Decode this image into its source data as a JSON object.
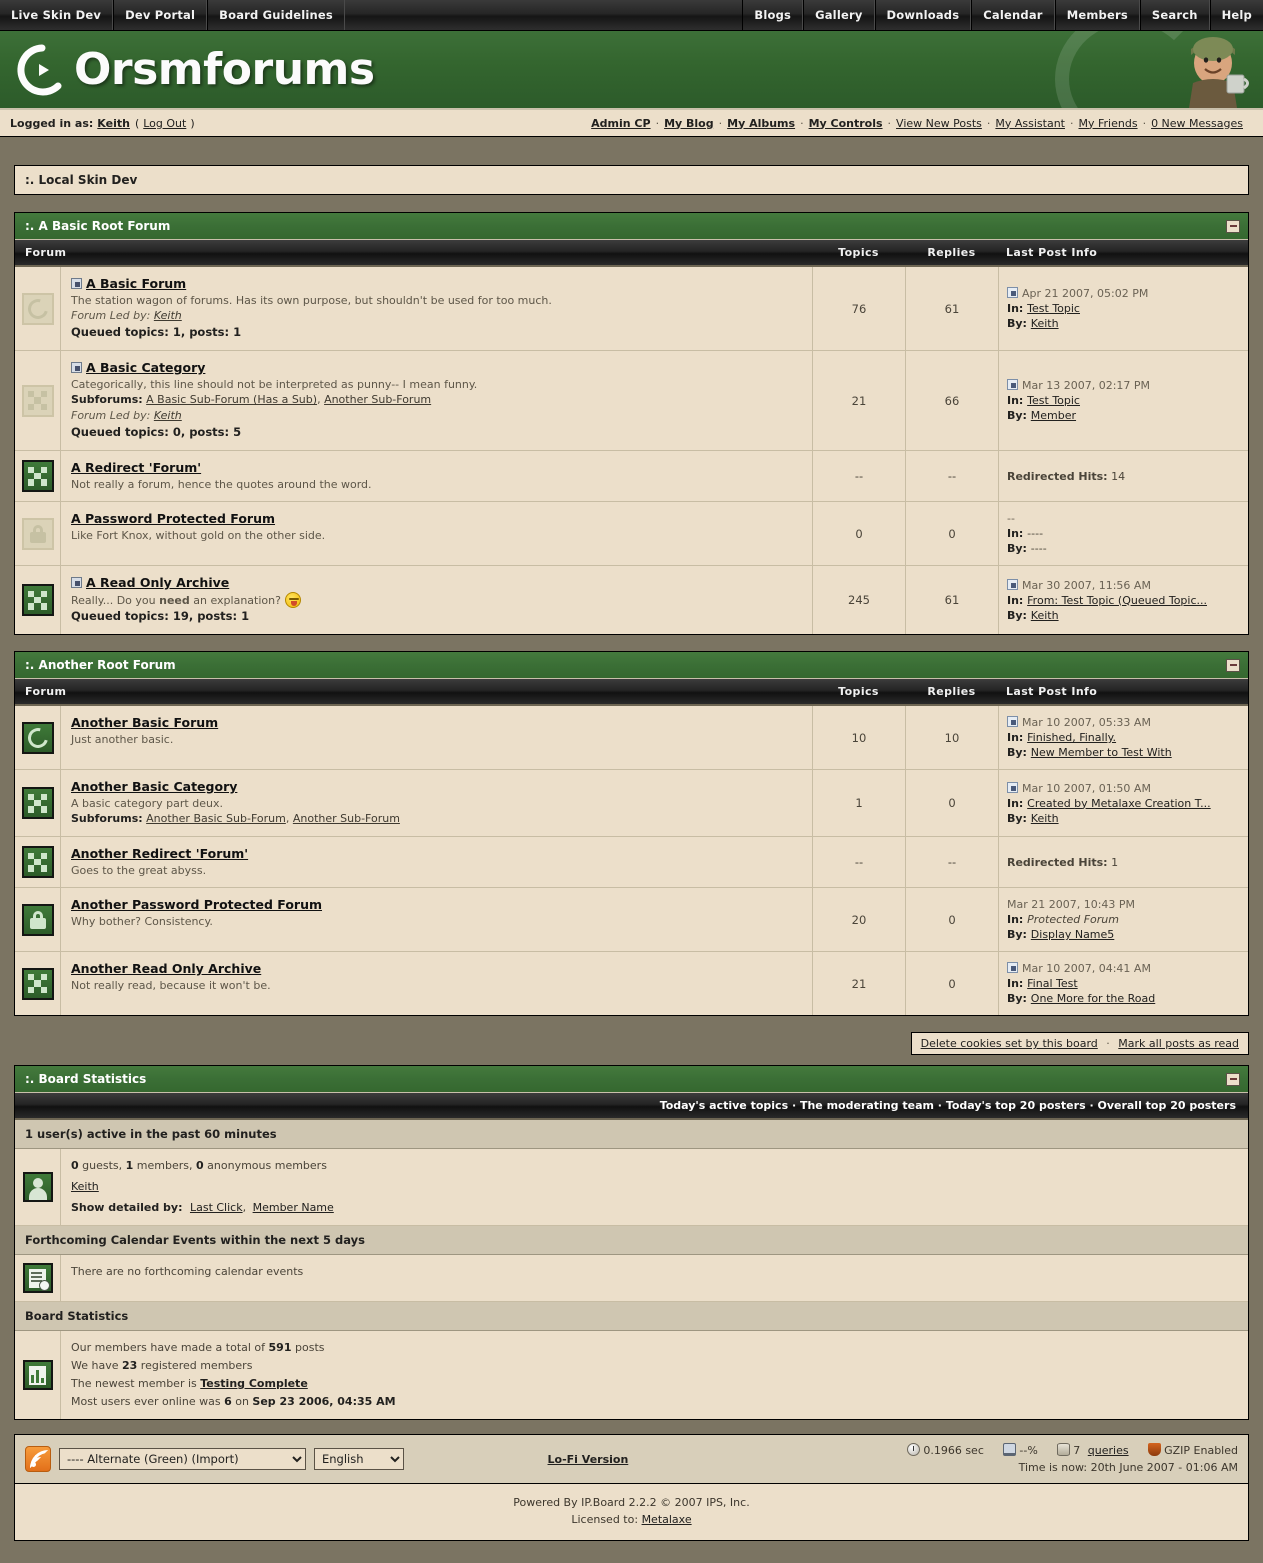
{
  "topnav": {
    "left": [
      "Live Skin Dev",
      "Dev Portal",
      "Board Guidelines"
    ],
    "right": [
      "Blogs",
      "Gallery",
      "Downloads",
      "Calendar",
      "Members",
      "Search",
      "Help"
    ]
  },
  "banner": {
    "logo_text": "Orsmforums"
  },
  "userbar": {
    "logged_label": "Logged in as:",
    "username": "Keith",
    "paren_open": "(",
    "logout": "Log Out",
    "paren_close": ")",
    "links": [
      "Admin CP",
      "My Blog",
      "My Albums",
      "My Controls",
      "View New Posts",
      "My Assistant",
      "My Friends",
      "0 New Messages"
    ]
  },
  "navstrip": ":. Local Skin Dev",
  "columns": {
    "forum": "Forum",
    "topics": "Topics",
    "replies": "Replies",
    "last_post": "Last Post Info"
  },
  "categories": [
    {
      "title": ":. A Basic Root Forum",
      "rows": [
        {
          "icon": "ring-icon",
          "icon_state": "off",
          "has_topic_icon": true,
          "name": "A Basic Forum",
          "desc": "The station wagon of forums. Has its own purpose, but shouldn't be used for too much.",
          "led_label": "Forum Led by:",
          "led_by": "Keith",
          "queued": "Queued topics: 1, posts: 1",
          "topics": "76",
          "replies": "61",
          "lp_date": "Apr 21 2007, 05:02 PM",
          "lp_date_icon": true,
          "lp_in_label": "In:",
          "lp_in": "Test Topic",
          "lp_in_link": true,
          "lp_by_label": "By:",
          "lp_by": "Keith",
          "lp_by_link": true
        },
        {
          "icon": "checker-icon",
          "icon_state": "off",
          "has_topic_icon": true,
          "name": "A Basic Category",
          "desc": "Categorically, this line should not be interpreted as punny-- I mean funny.",
          "sub_label": "Subforums:",
          "subforums": [
            "A Basic Sub-Forum (Has a Sub)",
            "Another Sub-Forum"
          ],
          "led_label": "Forum Led by:",
          "led_by": "Keith",
          "queued": "Queued topics: 0, posts: 5",
          "topics": "21",
          "replies": "66",
          "lp_date": "Mar 13 2007, 02:17 PM",
          "lp_date_icon": true,
          "lp_in_label": "In:",
          "lp_in": "Test Topic",
          "lp_in_link": true,
          "lp_by_label": "By:",
          "lp_by": "Member",
          "lp_by_link": true
        },
        {
          "icon": "checker-icon",
          "icon_state": "on",
          "has_topic_icon": false,
          "name": "A Redirect 'Forum'",
          "desc": "Not really a forum, hence the quotes around the word.",
          "topics": "--",
          "replies": "--",
          "redirect_label": "Redirected Hits:",
          "redirect_hits": "14"
        },
        {
          "icon": "lock-icon",
          "icon_state": "off",
          "has_topic_icon": false,
          "name": "A Password Protected Forum",
          "desc": "Like Fort Knox, without gold on the other side.",
          "topics": "0",
          "replies": "0",
          "lp_date": "--",
          "lp_date_icon": false,
          "lp_in_label": "In:",
          "lp_in": "----",
          "lp_in_link": false,
          "lp_by_label": "By:",
          "lp_by": "----",
          "lp_by_link": false
        },
        {
          "icon": "checker-icon",
          "icon_state": "on",
          "has_topic_icon": true,
          "name": "A Read Only Archive",
          "desc_pre": "Really... Do you ",
          "desc_bold": "need",
          "desc_post": " an explanation?",
          "has_smiley": true,
          "queued": "Queued topics: 19, posts: 1",
          "topics": "245",
          "replies": "61",
          "lp_date": "Mar 30 2007, 11:56 AM",
          "lp_date_icon": true,
          "lp_in_label": "In:",
          "lp_in": "From: Test Topic (Queued Topic...",
          "lp_in_link": true,
          "lp_by_label": "By:",
          "lp_by": "Keith",
          "lp_by_link": true
        }
      ]
    },
    {
      "title": ":. Another Root Forum",
      "rows": [
        {
          "icon": "ring-icon",
          "icon_state": "on",
          "has_topic_icon": false,
          "name": "Another Basic Forum",
          "desc": "Just another basic.",
          "topics": "10",
          "replies": "10",
          "lp_date": "Mar 10 2007, 05:33 AM",
          "lp_date_icon": true,
          "lp_in_label": "In:",
          "lp_in": "Finished, Finally.",
          "lp_in_link": true,
          "lp_by_label": "By:",
          "lp_by": "New Member to Test With",
          "lp_by_link": true
        },
        {
          "icon": "checker-icon",
          "icon_state": "on",
          "has_topic_icon": false,
          "name": "Another Basic Category",
          "desc": "A basic category part deux.",
          "sub_label": "Subforums:",
          "subforums": [
            "Another Basic Sub-Forum",
            "Another Sub-Forum"
          ],
          "topics": "1",
          "replies": "0",
          "lp_date": "Mar 10 2007, 01:50 AM",
          "lp_date_icon": true,
          "lp_in_label": "In:",
          "lp_in": "Created by Metalaxe Creation T...",
          "lp_in_link": true,
          "lp_by_label": "By:",
          "lp_by": "Keith",
          "lp_by_link": true
        },
        {
          "icon": "checker-icon",
          "icon_state": "on",
          "has_topic_icon": false,
          "name": "Another Redirect 'Forum'",
          "desc": "Goes to the great abyss.",
          "topics": "--",
          "replies": "--",
          "redirect_label": "Redirected Hits:",
          "redirect_hits": "1"
        },
        {
          "icon": "lock-icon",
          "icon_state": "on",
          "has_topic_icon": false,
          "name": "Another Password Protected Forum",
          "desc": "Why bother? Consistency.",
          "topics": "20",
          "replies": "0",
          "lp_date": "Mar 21 2007, 10:43 PM",
          "lp_date_icon": false,
          "lp_in_label": "In:",
          "lp_in": "Protected Forum",
          "lp_in_link": false,
          "lp_in_italic": true,
          "lp_by_label": "By:",
          "lp_by": "Display Name5",
          "lp_by_link": true
        },
        {
          "icon": "checker-icon",
          "icon_state": "on",
          "has_topic_icon": false,
          "name": "Another Read Only Archive",
          "desc": "Not really read, because it won't be.",
          "topics": "21",
          "replies": "0",
          "lp_date": "Mar 10 2007, 04:41 AM",
          "lp_date_icon": true,
          "lp_in_label": "In:",
          "lp_in": "Final Test",
          "lp_in_link": true,
          "lp_by_label": "By:",
          "lp_by": "One More for the Road",
          "lp_by_link": true
        }
      ]
    }
  ],
  "markread": {
    "delete_cookies": "Delete cookies set by this board",
    "mark_all": "Mark all posts as read"
  },
  "board_stats": {
    "title": ":. Board Statistics",
    "subnav": [
      "Today's active topics",
      "The moderating team",
      "Today's top 20 posters",
      "Overall top 20 posters"
    ],
    "active_head": "1 user(s) active in the past 60 minutes",
    "active_counts_guests": "0",
    "active_counts_guests_lbl": " guests, ",
    "active_counts_members": "1",
    "active_counts_members_lbl": " members, ",
    "active_counts_anon": "0",
    "active_counts_anon_lbl": " anonymous members",
    "active_user": "Keith",
    "show_detailed_label": "Show detailed by:",
    "show_detailed_opt1": "Last Click",
    "show_detailed_opt2": "Member Name",
    "calendar_head": "Forthcoming Calendar Events within the next 5 days",
    "calendar_empty": "There are no forthcoming calendar events",
    "stats_head": "Board Statistics",
    "line1_pre": "Our members have made a total of ",
    "line1_num": "591",
    "line1_post": " posts",
    "line2_pre": "We have ",
    "line2_num": "23",
    "line2_post": " registered members",
    "line3_pre": "The newest member is ",
    "line3_link": "Testing Complete",
    "line4_pre": "Most users ever online was ",
    "line4_num": "6",
    "line4_mid": " on ",
    "line4_date": "Sep 23 2006, 04:35 AM"
  },
  "footer": {
    "skin_selected": "---- Alternate (Green) (Import)",
    "lang_selected": "English",
    "lofi": "Lo-Fi Version",
    "exec_time": "0.1966 sec",
    "load": "--%",
    "queries_num": "7",
    "queries_label": "queries",
    "gzip": "GZIP Enabled",
    "time_now": "Time is now: 20th June 2007 - 01:06 AM",
    "powered": "Powered By IP.Board 2.2.2 © 2007  IPS, Inc.",
    "licensed_label": "Licensed to: ",
    "licensed_to": "Metalaxe"
  }
}
